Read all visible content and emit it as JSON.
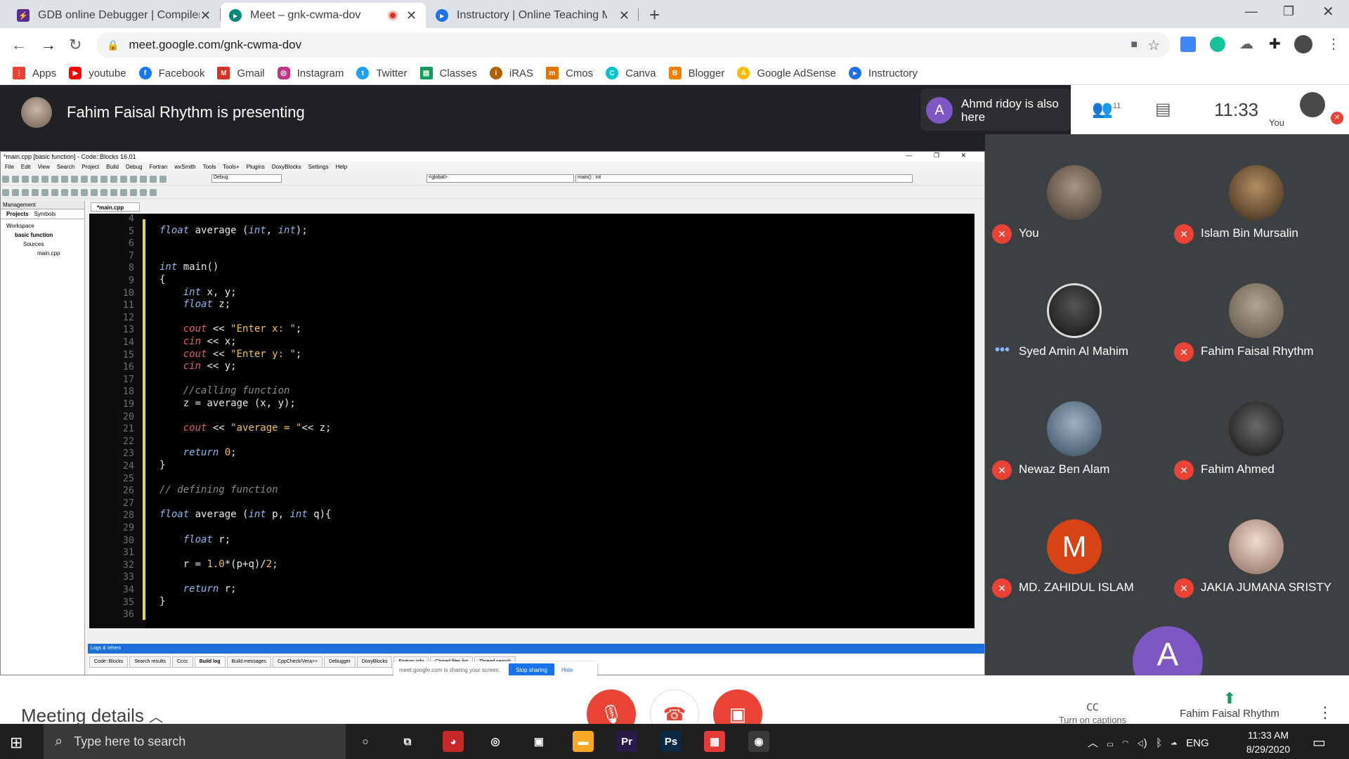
{
  "browser": {
    "tabs": [
      {
        "title": "GDB online Debugger | Compiler",
        "icon": "gdb-icon",
        "color": "#5c2d91"
      },
      {
        "title": "Meet – gnk-cwma-dov",
        "icon": "meet-icon",
        "color": "#00897b",
        "active": true
      },
      {
        "title": "Instructory | Online Teaching Ma",
        "icon": "instructory-icon",
        "color": "#1a73e8"
      }
    ],
    "url": "meet.google.com/gnk-cwma-dov",
    "bookmarks": [
      {
        "label": "Apps",
        "icon": "apps-grid-icon",
        "color": "#ea4335"
      },
      {
        "label": "youtube",
        "icon": "youtube-icon",
        "color": "#ff0000"
      },
      {
        "label": "Facebook",
        "icon": "facebook-icon",
        "color": "#1877f2"
      },
      {
        "label": "Gmail",
        "icon": "gmail-icon",
        "color": "#d93025"
      },
      {
        "label": "Instagram",
        "icon": "instagram-icon",
        "color": "#c13584"
      },
      {
        "label": "Twitter",
        "icon": "twitter-icon",
        "color": "#1da1f2"
      },
      {
        "label": "Classes",
        "icon": "classes-icon",
        "color": "#0f9d58"
      },
      {
        "label": "iRAS",
        "icon": "iras-icon",
        "color": "#b06000"
      },
      {
        "label": "Cmos",
        "icon": "cmos-icon",
        "color": "#e37400"
      },
      {
        "label": "Canva",
        "icon": "canva-icon",
        "color": "#00c4cc"
      },
      {
        "label": "Blogger",
        "icon": "blogger-icon",
        "color": "#f57d00"
      },
      {
        "label": "Google AdSense",
        "icon": "adsense-icon",
        "color": "#fbbc04"
      },
      {
        "label": "Instructory",
        "icon": "instructory-icon",
        "color": "#1a73e8"
      }
    ]
  },
  "meet": {
    "presenting": "Fahim Faisal Rhythm is presenting",
    "also_here": "Ahmd ridoy is also here",
    "also_here_initial": "A",
    "participant_count": "11",
    "clock": "11:33",
    "you_label": "You",
    "participants": [
      {
        "name": "You",
        "muted": true,
        "color": "#6b5e52"
      },
      {
        "name": "Islam Bin Mursalin",
        "muted": true,
        "color": "#7a6650"
      },
      {
        "name": "Syed Amin Al Mahim",
        "muted": false,
        "color": "#333333"
      },
      {
        "name": "Fahim Faisal Rhythm",
        "muted": true,
        "color": "#9c8a78"
      },
      {
        "name": "Newaz Ben Alam",
        "muted": true,
        "color": "#5c7083"
      },
      {
        "name": "Fahim Ahmed",
        "muted": true,
        "color": "#3a3a3a"
      },
      {
        "name": "MD. ZAHIDUL ISLAM",
        "muted": true,
        "initial": "M",
        "color": "#d84315"
      },
      {
        "name": "JAKIA JUMANA SRISTY",
        "muted": true,
        "color": "#c8a898"
      }
    ],
    "extra_tile_initial": "A",
    "meeting_details": "Meeting details",
    "captions_label": "Turn on captions",
    "presenter_button_label": "Fahim Faisal Rhythm"
  },
  "screen_share": {
    "window_title": "*main.cpp [basic function] - Code::Blocks 16.01",
    "menu": [
      "File",
      "Edit",
      "View",
      "Search",
      "Project",
      "Build",
      "Debug",
      "Fortran",
      "wxSmith",
      "Tools",
      "Tools+",
      "Plugins",
      "DoxyBlocks",
      "Settings",
      "Help"
    ],
    "build_target": "Debug",
    "scope": "<global>",
    "symbol": "main() : int",
    "management_title": "Management",
    "management_tabs": [
      "Projects",
      "Symbols"
    ],
    "tree": [
      "Workspace",
      "basic function",
      "Sources",
      "main.cpp"
    ],
    "editor_tab": "*main.cpp",
    "lines": [
      {
        "n": "4",
        "code": ""
      },
      {
        "n": "5",
        "code": "float average (int, int);"
      },
      {
        "n": "6",
        "code": ""
      },
      {
        "n": "7",
        "code": ""
      },
      {
        "n": "8",
        "code": "int main()"
      },
      {
        "n": "9",
        "code": "{"
      },
      {
        "n": "10",
        "code": "    int x, y;"
      },
      {
        "n": "11",
        "code": "    float z;"
      },
      {
        "n": "12",
        "code": ""
      },
      {
        "n": "13",
        "code": "    cout << \"Enter x: \";"
      },
      {
        "n": "14",
        "code": "    cin << x;"
      },
      {
        "n": "15",
        "code": "    cout << \"Enter y: \";"
      },
      {
        "n": "16",
        "code": "    cin << y;"
      },
      {
        "n": "17",
        "code": ""
      },
      {
        "n": "18",
        "code": "    //calling function"
      },
      {
        "n": "19",
        "code": "    z = average (x, y);"
      },
      {
        "n": "20",
        "code": ""
      },
      {
        "n": "21",
        "code": "    cout << \"average = \"<< z;"
      },
      {
        "n": "22",
        "code": ""
      },
      {
        "n": "23",
        "code": "    return 0;"
      },
      {
        "n": "24",
        "code": "}"
      },
      {
        "n": "25",
        "code": ""
      },
      {
        "n": "26",
        "code": "// defining function"
      },
      {
        "n": "27",
        "code": ""
      },
      {
        "n": "28",
        "code": "float average (int p, int q){"
      },
      {
        "n": "29",
        "code": ""
      },
      {
        "n": "30",
        "code": "    float r;"
      },
      {
        "n": "31",
        "code": ""
      },
      {
        "n": "32",
        "code": "    r = 1.0*(p+q)/2;"
      },
      {
        "n": "33",
        "code": ""
      },
      {
        "n": "34",
        "code": "    return r;"
      },
      {
        "n": "35",
        "code": "}"
      },
      {
        "n": "36",
        "code": ""
      }
    ],
    "logs_title": "Logs & others",
    "log_tabs": [
      "Code::Blocks",
      "Search results",
      "Cccc",
      "Build log",
      "Build messages",
      "CppCheck/Vera++",
      "Debugger",
      "DoxyBlocks",
      "Fortran info",
      "Closed files list",
      "Thread search"
    ],
    "share_notice": "meet.google.com is sharing your screen.",
    "stop_sharing": "Stop sharing",
    "hide": "Hide"
  },
  "taskbar": {
    "search_placeholder": "Type here to search",
    "language": "ENG",
    "time": "11:33 AM",
    "date": "8/29/2020",
    "apps": [
      {
        "icon": "cortana-icon",
        "glyph": "○",
        "color": "transparent"
      },
      {
        "icon": "task-view-icon",
        "glyph": "⧉",
        "color": "transparent"
      },
      {
        "icon": "paint-icon",
        "glyph": "◕",
        "color": "#c62828"
      },
      {
        "icon": "obs-icon",
        "glyph": "◎",
        "color": "transparent"
      },
      {
        "icon": "store-icon",
        "glyph": "▣",
        "color": "transparent"
      },
      {
        "icon": "explorer-icon",
        "glyph": "▬",
        "color": "#f9a825"
      },
      {
        "icon": "premiere-icon",
        "glyph": "Pr",
        "color": "#2a1a4a"
      },
      {
        "icon": "photoshop-icon",
        "glyph": "Ps",
        "color": "#0a2a44"
      },
      {
        "icon": "windows-store-tiles-icon",
        "glyph": "▦",
        "color": "#e53935"
      },
      {
        "icon": "chrome-icon",
        "glyph": "◉",
        "color": "#3a3a3a"
      }
    ]
  }
}
